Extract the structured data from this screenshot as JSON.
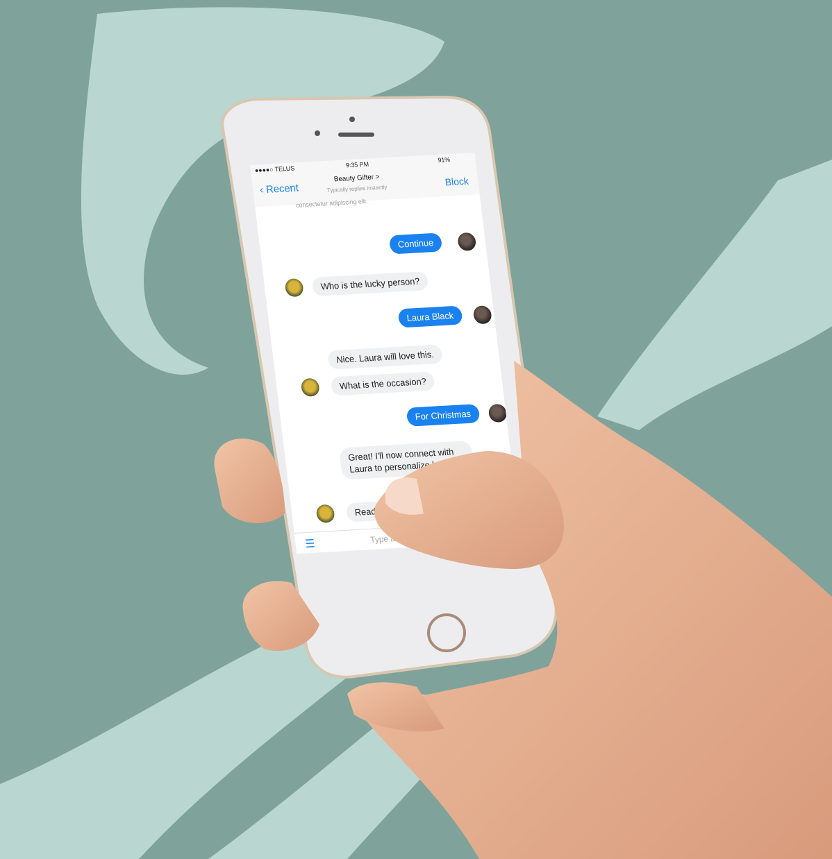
{
  "colors": {
    "background": "#7fa39a",
    "brush": "#b9d6d0",
    "accent": "#1a82f0",
    "phone_body": "#ededf0",
    "skin": "#e8b596"
  },
  "status_bar": {
    "carrier": "●●●●○ TELUS",
    "time": "9:35 PM",
    "battery": "91%"
  },
  "nav": {
    "back_label": "Recent",
    "title": "Beauty Gifter >",
    "subtitle": "Typically replies instantly",
    "block_label": "Block"
  },
  "chat": {
    "truncated_top": "consectetur adipiscing elit.",
    "messages": [
      {
        "from": "me",
        "text": "Continue"
      },
      {
        "from": "bot",
        "text": "Who is the lucky person?"
      },
      {
        "from": "me",
        "text": "Laura Black"
      },
      {
        "from": "bot",
        "text": "Nice. Laura will love this."
      },
      {
        "from": "bot",
        "text": "What is the occasion?"
      },
      {
        "from": "me",
        "text": "For Christmas"
      },
      {
        "from": "bot",
        "text": "Great! I'll now connect with Laura to personalize her gift."
      },
      {
        "from": "bot",
        "text": "Ready"
      }
    ]
  },
  "input": {
    "placeholder": "Type a message..."
  },
  "icons": {
    "back": "chevron-left-icon",
    "menu": "hamburger-menu-icon",
    "home": "home-button-icon"
  }
}
